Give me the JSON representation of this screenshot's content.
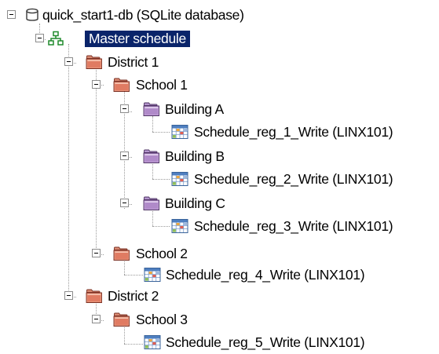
{
  "theme": {
    "selection_bg": "#0a246a",
    "selection_text": "#ffffff",
    "connector_color": "#9a9a9a",
    "folder_orange": "#e8957c",
    "folder_purple": "#c2a0d8"
  },
  "tree": {
    "root": {
      "label": "quick_start1-db (SQLite database)",
      "icon": "database-icon",
      "expanded": true
    },
    "master": {
      "label": "Master schedule",
      "icon": "hierarchy-icon",
      "selected": true,
      "expanded": true
    },
    "district_1": {
      "label": "District 1",
      "icon": "folder-icon"
    },
    "school_1": {
      "label": "School 1",
      "icon": "folder-icon"
    },
    "building_a": {
      "label": "Building A",
      "icon": "folder-icon"
    },
    "schedule_1": {
      "label": "Schedule_reg_1_Write (LINX101)",
      "icon": "schedule-grid-icon"
    },
    "building_b": {
      "label": "Building B",
      "icon": "folder-icon"
    },
    "schedule_2": {
      "label": "Schedule_reg_2_Write (LINX101)",
      "icon": "schedule-grid-icon"
    },
    "building_c": {
      "label": "Building C",
      "icon": "folder-icon"
    },
    "schedule_3": {
      "label": "Schedule_reg_3_Write (LINX101)",
      "icon": "schedule-grid-icon"
    },
    "school_2": {
      "label": "School 2",
      "icon": "folder-icon"
    },
    "schedule_4": {
      "label": "Schedule_reg_4_Write (LINX101)",
      "icon": "schedule-grid-icon"
    },
    "district_2": {
      "label": "District 2",
      "icon": "folder-icon"
    },
    "school_3": {
      "label": "School 3",
      "icon": "folder-icon"
    },
    "schedule_5": {
      "label": "Schedule_reg_5_Write (LINX101)",
      "icon": "schedule-grid-icon"
    }
  }
}
